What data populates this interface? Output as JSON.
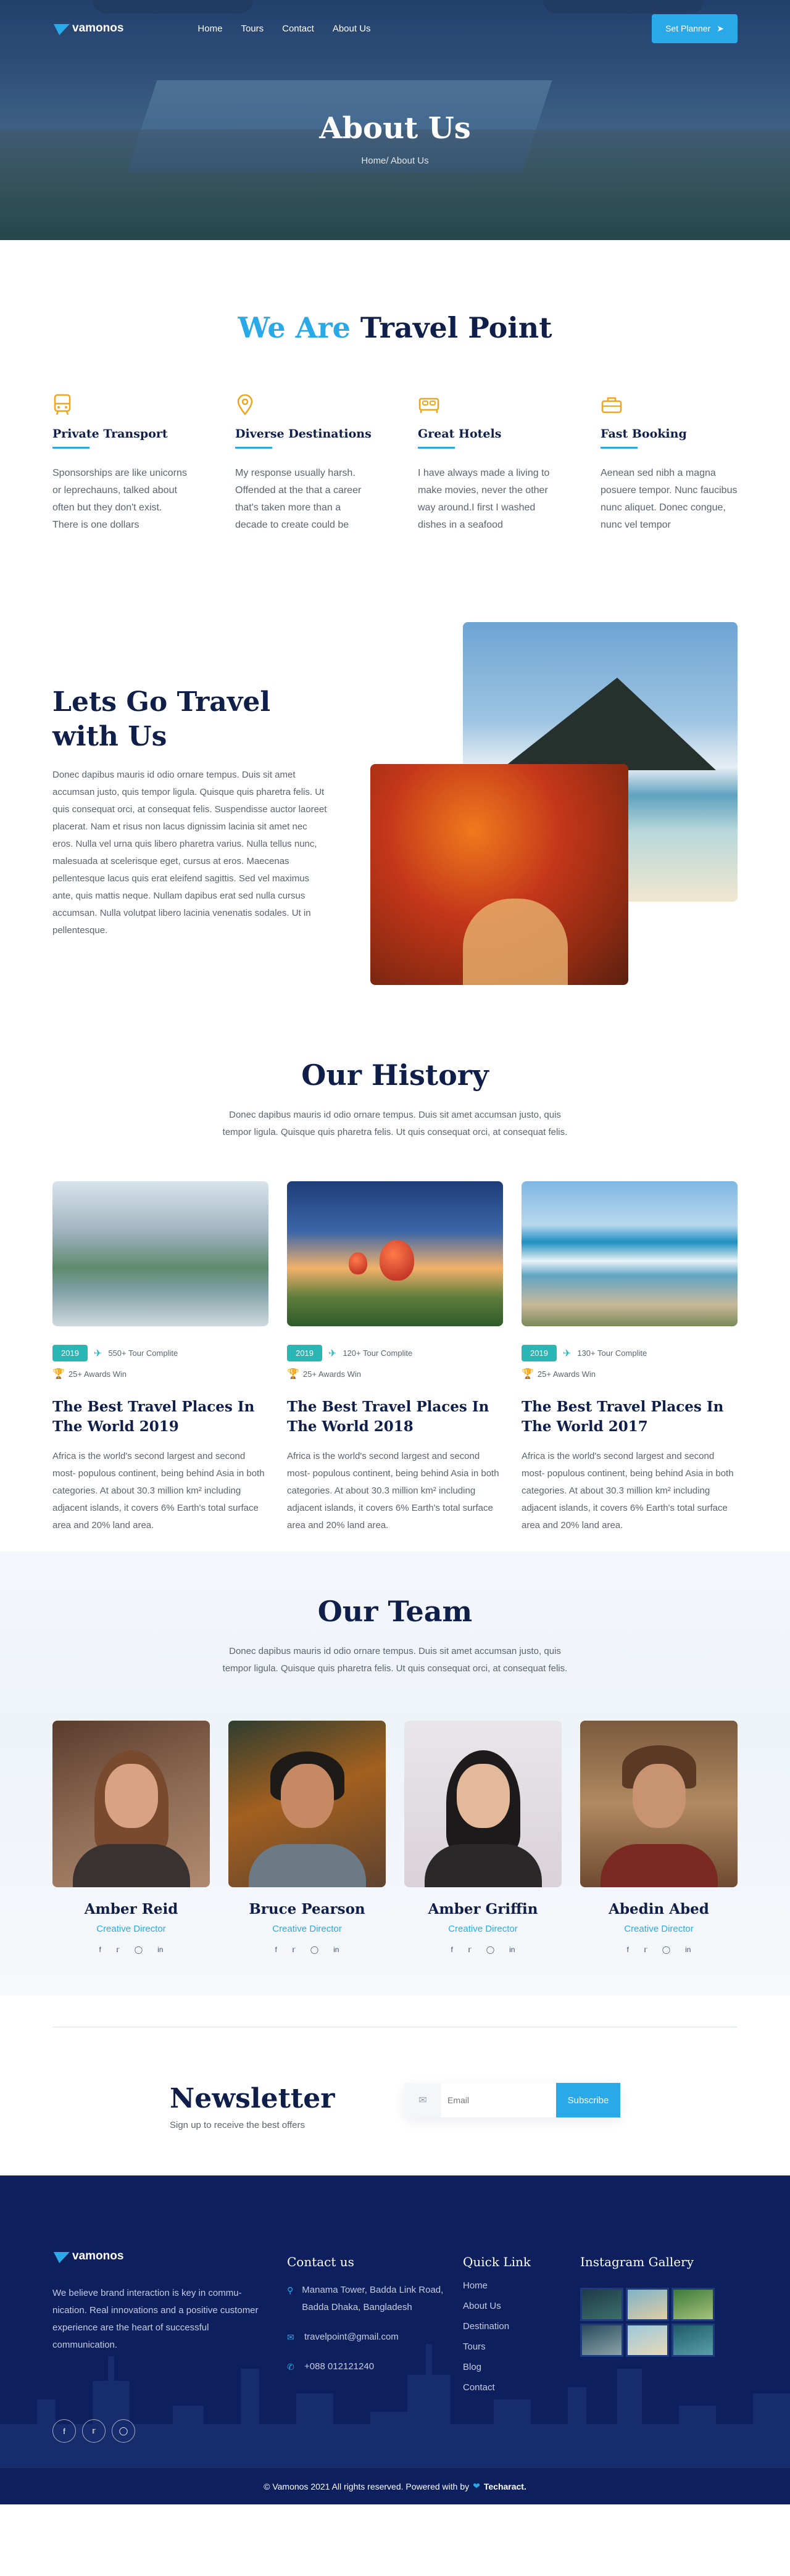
{
  "nav": {
    "logo_text": "vamonos",
    "links": [
      "Home",
      "Tours",
      "Contact",
      "About Us"
    ],
    "cta_label": "Set Planner"
  },
  "hero": {
    "title": "About Us",
    "breadcrumb": "Home/ About Us"
  },
  "intro": {
    "title_accent": "We Are",
    "title_rest": "Travel Point",
    "features": [
      {
        "icon": "bus-icon",
        "title": "Private Transport",
        "text": "Sponsorships are like unicorns or leprechauns, talked about often but they don't exist. There is one dollars"
      },
      {
        "icon": "map-pin-icon",
        "title": "Diverse Destinations",
        "text": "My response usually harsh. Offended at the that a career that's taken more than a decade to create could be"
      },
      {
        "icon": "bed-icon",
        "title": "Great Hotels",
        "text": "I have always made a living to make movies, never the other way around.I first I washed dishes in a seafood"
      },
      {
        "icon": "luggage-icon",
        "title": "Fast Booking",
        "text": "Aenean sed nibh a magna posuere tempor. Nunc faucibus nunc aliquet. Donec congue, nunc vel tempor"
      }
    ]
  },
  "letsgo": {
    "title": "Lets Go Travel with Us",
    "text": "Donec dapibus mauris id odio ornare tempus. Duis sit amet accumsan justo, quis tempor ligula. Quisque quis pharetra felis. Ut quis consequat orci, at consequat felis. Suspendisse auctor laoreet placerat. Nam et risus non lacus dignissim lacinia sit amet nec eros. Nulla vel urna quis libero pharetra varius. Nulla tellus nunc, malesuada at scelerisque eget, cursus at eros. Maecenas pellentesque lacus quis erat eleifend sagittis. Sed vel maximus ante, quis mattis neque. Nullam dapibus erat sed nulla cursus accumsan. Nulla volutpat libero lacinia venenatis sodales. Ut in pellentesque."
  },
  "history": {
    "title": "Our History",
    "subtitle": "Donec dapibus mauris id odio ornare tempus. Duis sit amet accumsan justo, quis tempor ligula. Quisque quis pharetra felis. Ut quis consequat orci, at consequat felis.",
    "cards": [
      {
        "year": "2019",
        "tours": "550+ Tour Complite",
        "awards": "25+ Awards Win",
        "title": "The Best Travel Places In The World 2019",
        "text": "Africa is the world's second largest and second most- populous continent, being behind Asia in both categories. At about 30.3 million km² including adjacent islands, it covers 6% Earth's total surface area and 20% land area."
      },
      {
        "year": "2019",
        "tours": "120+ Tour Complite",
        "awards": "25+ Awards Win",
        "title": "The Best Travel Places In The World 2018",
        "text": "Africa is the world's second largest and second most- populous continent, being behind Asia in both categories. At about 30.3 million km² including adjacent islands, it covers 6% Earth's total surface area and 20% land area."
      },
      {
        "year": "2019",
        "tours": "130+ Tour Complite",
        "awards": "25+ Awards Win",
        "title": "The Best Travel Places In The World 2017",
        "text": "Africa is the world's second largest and second most- populous continent, being behind Asia in both categories. At about 30.3 million km² including adjacent islands, it covers 6% Earth's total surface area and 20% land area."
      }
    ]
  },
  "team": {
    "title": "Our Team",
    "subtitle": "Donec dapibus mauris id odio ornare tempus. Duis sit amet accumsan justo, quis tempor ligula. Quisque quis pharetra felis. Ut quis consequat orci, at consequat felis.",
    "members": [
      {
        "name": "Amber Reid",
        "role": "Creative Director"
      },
      {
        "name": "Bruce Pearson",
        "role": "Creative Director"
      },
      {
        "name": "Amber Griffin",
        "role": "Creative Director"
      },
      {
        "name": "Abedin Abed",
        "role": "Creative Director"
      }
    ],
    "social_icons": [
      "f",
      "t",
      "ig",
      "in"
    ]
  },
  "newsletter": {
    "title": "Newsletter",
    "subtitle": "Sign up to receive the best offers",
    "placeholder": "Email",
    "button_label": "Subscribe"
  },
  "footer": {
    "logo_text": "vamonos",
    "about_text": "We believe brand interaction is key in commu- nication. Real innovations and a positive customer experience are the heart of successful communication.",
    "contact_title": "Contact us",
    "address": "Manama Tower, Badda Link Road, Badda Dhaka, Bangladesh",
    "email": "travelpoint@gmail.com",
    "phone": "+088 012121240",
    "quick_title": "Quick Link",
    "quick_links": [
      "Home",
      "About Us",
      "Destination",
      "Tours",
      "Blog",
      "Contact"
    ],
    "gallery_title": "Instagram Gallery",
    "copyright": "© Vamonos 2021 All rights reserved. Powered with by",
    "credit": "Techaract."
  },
  "colors": {
    "accent": "#29a9e8",
    "navy": "#0f1f4a",
    "footer_bg": "#0d1f5c",
    "teal": "#2bb6b6",
    "icon_orange": "#f0a51d"
  }
}
